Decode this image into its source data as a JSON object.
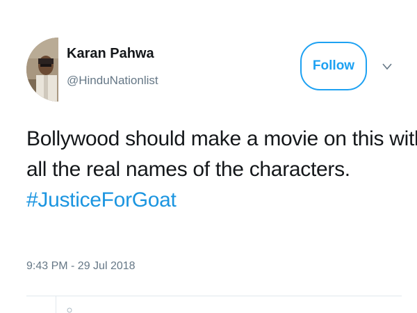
{
  "tweet": {
    "author_name": "Karan Pahwa",
    "author_handle": "@HinduNationlist",
    "follow_label": "Follow",
    "text_line_1": "Bollywood should make a movie on this with",
    "text_line_2": "all the real names of the characters.",
    "hashtag": "#JusticeForGoat",
    "timestamp": "9:43 PM - 29 Jul 2018"
  },
  "icons": {
    "caret": "chevron-down-icon",
    "avatar": "user-avatar"
  },
  "colors": {
    "accent": "#1da1f2",
    "hashtag": "#1b95e0",
    "text": "#14171a",
    "muted": "#657786",
    "divider": "#e1e8ed"
  }
}
